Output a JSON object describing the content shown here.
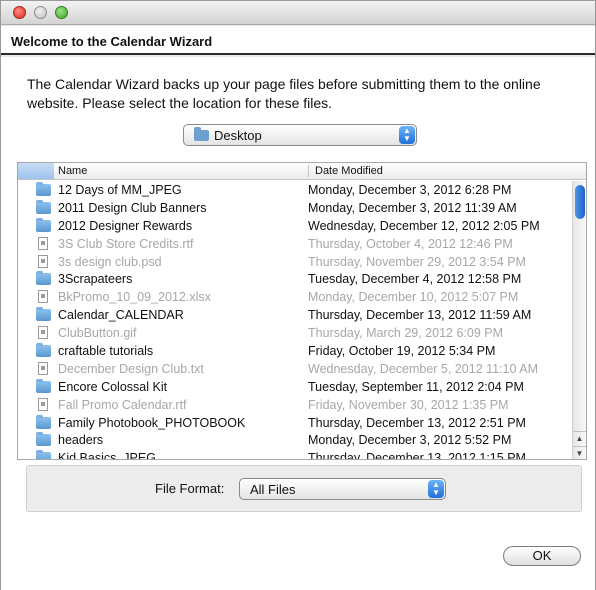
{
  "header": {
    "title": "Welcome to the Calendar Wizard"
  },
  "intro": "The Calendar Wizard backs up your page files before submitting them to the online website. Please select the location for these files.",
  "location": {
    "selected": "Desktop"
  },
  "columns": {
    "name": "Name",
    "date": "Date Modified"
  },
  "files": [
    {
      "name": "12 Days of MM_JPEG",
      "date": "Monday, December 3, 2012 6:28 PM",
      "enabled": true,
      "icon": "folder-icon"
    },
    {
      "name": "2011 Design Club Banners",
      "date": "Monday, December 3, 2012 11:39 AM",
      "enabled": true,
      "icon": "folder-icon"
    },
    {
      "name": "2012 Designer Rewards",
      "date": "Wednesday, December 12, 2012 2:05 PM",
      "enabled": true,
      "icon": "folder-icon"
    },
    {
      "name": "3S Club Store Credits.rtf",
      "date": "Thursday, October 4, 2012 12:46 PM",
      "enabled": false,
      "icon": "document-icon"
    },
    {
      "name": "3s design club.psd",
      "date": "Thursday, November 29, 2012 3:54 PM",
      "enabled": false,
      "icon": "document-icon"
    },
    {
      "name": "3Scrapateers",
      "date": "Tuesday, December 4, 2012 12:58 PM",
      "enabled": true,
      "icon": "folder-icon"
    },
    {
      "name": "BkPromo_10_09_2012.xlsx",
      "date": "Monday, December 10, 2012 5:07 PM",
      "enabled": false,
      "icon": "document-icon"
    },
    {
      "name": "Calendar_CALENDAR",
      "date": "Thursday, December 13, 2012 11:59 AM",
      "enabled": true,
      "icon": "folder-icon"
    },
    {
      "name": "ClubButton.gif",
      "date": "Thursday, March 29, 2012 6:09 PM",
      "enabled": false,
      "icon": "document-icon"
    },
    {
      "name": "craftable tutorials",
      "date": "Friday, October 19, 2012 5:34 PM",
      "enabled": true,
      "icon": "folder-icon"
    },
    {
      "name": "December Design Club.txt",
      "date": "Wednesday, December 5, 2012 11:10 AM",
      "enabled": false,
      "icon": "document-icon"
    },
    {
      "name": "Encore Colossal Kit",
      "date": "Tuesday, September 11, 2012 2:04 PM",
      "enabled": true,
      "icon": "folder-icon"
    },
    {
      "name": "Fall Promo Calendar.rtf",
      "date": "Friday, November 30, 2012 1:35 PM",
      "enabled": false,
      "icon": "document-icon"
    },
    {
      "name": "Family Photobook_PHOTOBOOK",
      "date": "Thursday, December 13, 2012 2:51 PM",
      "enabled": true,
      "icon": "folder-icon"
    },
    {
      "name": "headers",
      "date": "Monday, December 3, 2012 5:52 PM",
      "enabled": true,
      "icon": "folder-icon"
    },
    {
      "name": "Kid Basics_JPEG",
      "date": "Thursday, December 13, 2012 1:15 PM",
      "enabled": true,
      "icon": "folder-icon"
    }
  ],
  "format": {
    "label": "File Format:",
    "selected": "All Files"
  },
  "ok_label": "OK"
}
